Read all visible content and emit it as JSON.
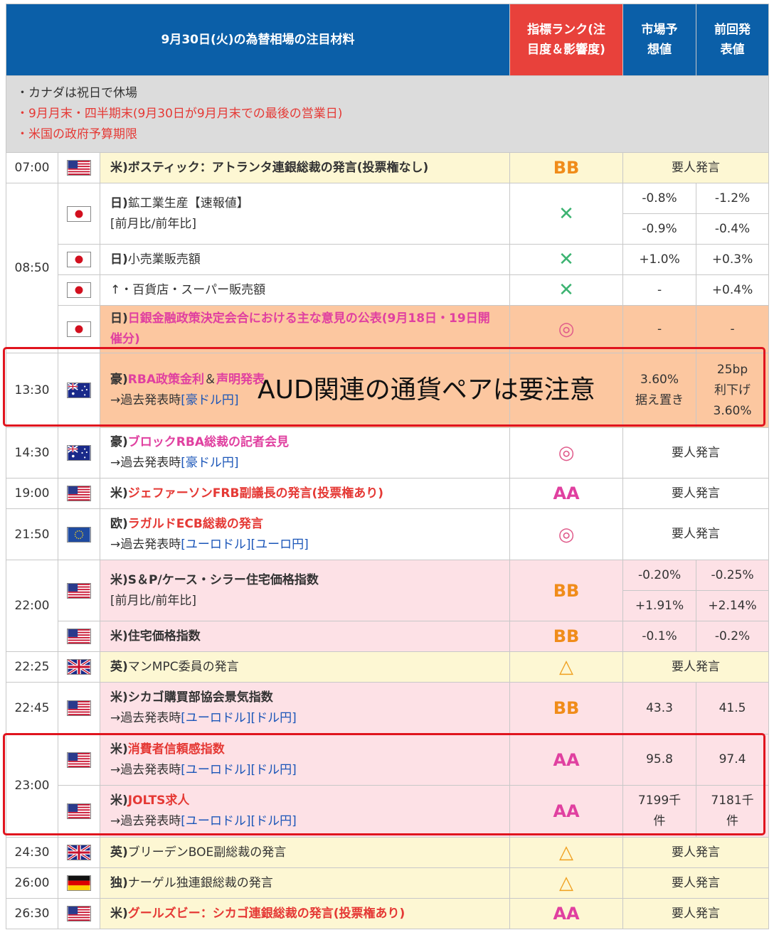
{
  "header": {
    "title": "9月30日(火)の為替相場の注目材料",
    "rank_label": "指標ランク(注目度＆影響度)",
    "forecast_label": "市場予想値",
    "previous_label": "前回発表値"
  },
  "notes": [
    "・カナダは祝日で休場",
    "・9月月末・四半期末(9月30日が9月月末での最後の営業日)",
    "・米国の政府予算期限"
  ],
  "overlay": "AUD関連の通貨ペアは要注意",
  "rows": {
    "r0700": {
      "time": "07:00",
      "country": "米)",
      "title": "ボスティック：アトランタ連銀総裁の発言(投票権なし)",
      "rank": "BB",
      "value": "要人発言"
    },
    "r0850a": {
      "time": "08:50",
      "country": "日)",
      "title": "鉱工業生産【速報値】",
      "sub": "[前月比/前年比]",
      "rank": "✕",
      "f1": "-0.8%",
      "p1": "-1.2%",
      "f2": "-0.9%",
      "p2": "-0.4%"
    },
    "r0850b": {
      "country": "日)",
      "title": "小売業販売額",
      "rank": "✕",
      "f": "+1.0%",
      "p": "+0.3%"
    },
    "r0850c": {
      "title": "↑・百貨店・スーパー販売額",
      "rank": "✕",
      "f": "-",
      "p": "+0.4%"
    },
    "r0850d": {
      "country": "日)",
      "title": "日銀金融政策決定会合における主な意見の公表(9月18日・19日開催分)",
      "rank": "◎",
      "f": "-",
      "p": "-"
    },
    "r1330": {
      "time": "13:30",
      "country": "豪)",
      "title1": "RBA政策金利",
      "amp": "＆",
      "title2": "声明発表",
      "sub_prefix": "→過去発表時",
      "link1": "[豪ドル円]",
      "f1": "3.60%",
      "f2": "据え置き",
      "p1": "25bp",
      "p2": "利下げ",
      "p3": "3.60%"
    },
    "r1430": {
      "time": "14:30",
      "country": "豪)",
      "title": "ブロックRBA総裁の記者会見",
      "sub_prefix": "→過去発表時",
      "link1": "[豪ドル円]",
      "rank": "◎",
      "value": "要人発言"
    },
    "r1900": {
      "time": "19:00",
      "country": "米)",
      "title": "ジェファーソンFRB副議長の発言(投票権あり)",
      "rank": "AA",
      "value": "要人発言"
    },
    "r2150": {
      "time": "21:50",
      "country": "欧)",
      "title": "ラガルドECB総裁の発言",
      "sub_prefix": "→過去発表時",
      "link1": "[ユーロドル]",
      "link2": "[ユーロ円]",
      "rank": "◎",
      "value": "要人発言"
    },
    "r2200a": {
      "time": "22:00",
      "country": "米)",
      "title": "S＆P/ケース・シラー住宅価格指数",
      "sub": "[前月比/前年比]",
      "rank": "BB",
      "f1": "-0.20%",
      "p1": "-0.25%",
      "f2": "+1.91%",
      "p2": "+2.14%"
    },
    "r2200b": {
      "country": "米)",
      "title": "住宅価格指数",
      "rank": "BB",
      "f": "-0.1%",
      "p": "-0.2%"
    },
    "r2225": {
      "time": "22:25",
      "country": "英)",
      "title": "マンMPC委員の発言",
      "rank": "△",
      "value": "要人発言"
    },
    "r2245": {
      "time": "22:45",
      "country": "米)",
      "title": "シカゴ購買部協会景気指数",
      "sub_prefix": "→過去発表時",
      "link1": "[ユーロドル]",
      "link2": "[ドル円]",
      "rank": "BB",
      "f": "43.3",
      "p": "41.5"
    },
    "r2300a": {
      "time": "23:00",
      "country": "米)",
      "title": "消費者信頼感指数",
      "sub_prefix": "→過去発表時",
      "link1": "[ユーロドル]",
      "link2": "[ドル円]",
      "rank": "AA",
      "f": "95.8",
      "p": "97.4"
    },
    "r2300b": {
      "country": "米)",
      "title": "JOLTS求人",
      "sub_prefix": "→過去発表時",
      "link1": "[ユーロドル]",
      "link2": "[ドル円]",
      "rank": "AA",
      "f1": "7199千",
      "f2": "件",
      "p1": "7181千",
      "p2": "件"
    },
    "r2430": {
      "time": "24:30",
      "country": "英)",
      "title": "ブリーデンBOE副総裁の発言",
      "rank": "△",
      "value": "要人発言"
    },
    "r2600": {
      "time": "26:00",
      "country": "独)",
      "title": "ナーゲル独連銀総裁の発言",
      "rank": "△",
      "value": "要人発言"
    },
    "r2630": {
      "time": "26:30",
      "country": "米)",
      "title": "グールズビー：シカゴ連銀総裁の発言(投票権あり)",
      "rank": "AA",
      "value": "要人発言"
    }
  },
  "flag_icons": {
    "us": "us-flag-icon",
    "jp": "japan-flag-icon",
    "au": "australia-flag-icon",
    "eu": "eu-flag-icon",
    "uk": "uk-flag-icon",
    "de": "germany-flag-icon"
  },
  "colors": {
    "header_blue": "#0b5fa8",
    "rank_header_red": "#e8413b",
    "row_yellow": "#fdf7d3",
    "row_pink": "#fde1e6",
    "row_orange": "#fcc7a0",
    "highlight_red": "#e0141e"
  }
}
